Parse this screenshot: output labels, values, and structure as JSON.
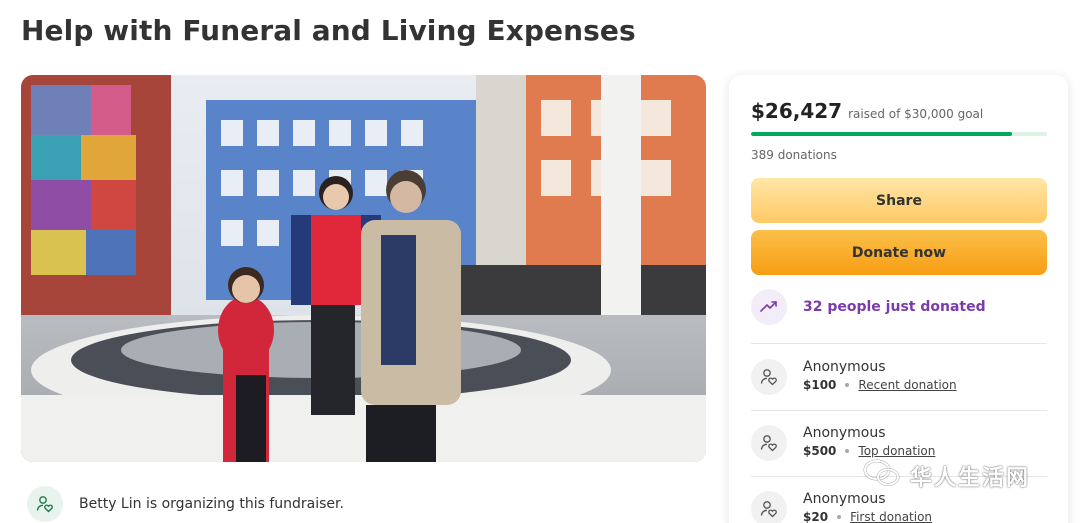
{
  "page": {
    "title": "Help with Funeral and Living Expenses"
  },
  "organizer": {
    "text": "Betty Lin is organizing this fundraiser.",
    "icon": "user-heart-icon"
  },
  "donation_card": {
    "raised": "$26,427",
    "goal_text": "raised of $30,000 goal",
    "progress_fraction": 0.8809,
    "count_text": "389 donations",
    "share_label": "Share",
    "donate_label": "Donate now",
    "trend_text": "32 people just donated",
    "trend_icon": "trending-up-icon",
    "accent_green": "#02a95c",
    "accent_purple": "#7c3aab",
    "donations": [
      {
        "name": "Anonymous",
        "amount": "$100",
        "tag": "Recent donation"
      },
      {
        "name": "Anonymous",
        "amount": "$500",
        "tag": "Top donation"
      },
      {
        "name": "Anonymous",
        "amount": "$20",
        "tag": "First donation"
      }
    ]
  },
  "watermark": {
    "text": "华人生活网"
  }
}
